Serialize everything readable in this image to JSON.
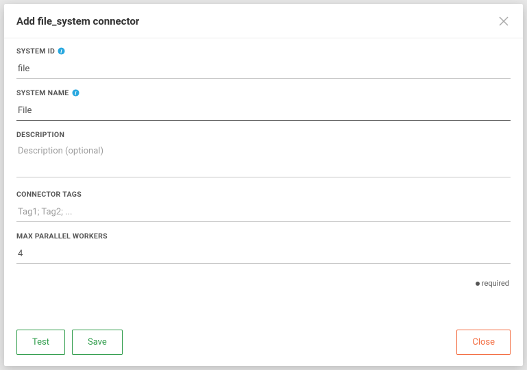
{
  "modal": {
    "title": "Add file_system connector",
    "fields": {
      "systemId": {
        "label": "SYSTEM ID",
        "value": "file",
        "hasInfo": true
      },
      "systemName": {
        "label": "SYSTEM NAME",
        "value": "File",
        "hasInfo": true
      },
      "description": {
        "label": "DESCRIPTION",
        "placeholder": "Description (optional)"
      },
      "connectorTags": {
        "label": "CONNECTOR TAGS",
        "placeholder": "Tag1; Tag2; ..."
      },
      "maxParallelWorkers": {
        "label": "MAX PARALLEL WORKERS",
        "value": "4"
      }
    },
    "requiredLabel": "required",
    "buttons": {
      "test": "Test",
      "save": "Save",
      "close": "Close"
    }
  }
}
